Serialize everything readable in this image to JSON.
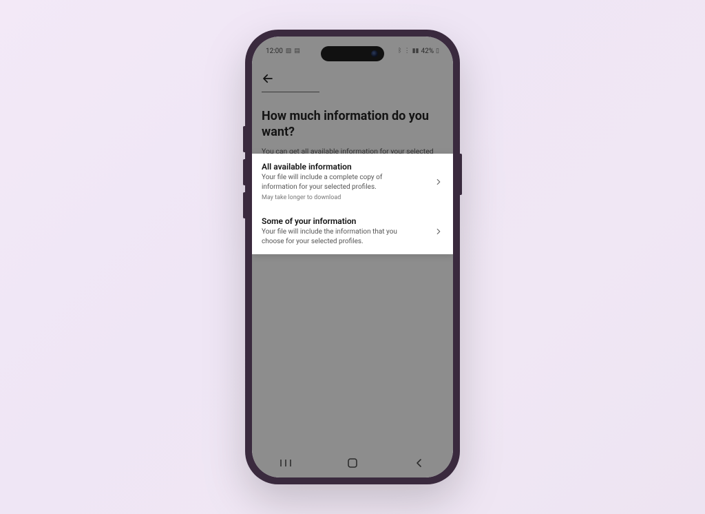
{
  "status_bar": {
    "time": "12:00",
    "battery_text": "42%",
    "left_icons": [
      "image-icon",
      "app-icon"
    ],
    "right_icons": [
      "bt-icon",
      "wifi-icon",
      "signal-icon",
      "battery-icon"
    ]
  },
  "page": {
    "heading": "How much information do you want?",
    "subheading": "You can get all available information for your selected profile or choose specific information."
  },
  "options": [
    {
      "title": "All available information",
      "desc": "Your file will include a complete copy of information for your selected profiles.",
      "note": "May take longer to download"
    },
    {
      "title": "Some of your information",
      "desc": "Your file will include the information that you choose for your selected profiles.",
      "note": ""
    }
  ]
}
